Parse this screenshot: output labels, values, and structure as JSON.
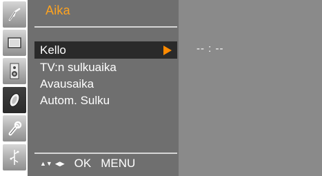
{
  "menu": {
    "title": "Aika",
    "items": [
      {
        "label": "Kello",
        "selected": true
      },
      {
        "label": "TV:n sulkuaika",
        "selected": false
      },
      {
        "label": "Avausaika",
        "selected": false
      },
      {
        "label": "Autom. Sulku",
        "selected": false
      }
    ]
  },
  "value": {
    "clock": "-- : --"
  },
  "footer": {
    "nav_icons": [
      "up-down-arrows-icon",
      "left-right-arrows-icon"
    ],
    "ok_label": "OK",
    "menu_label": "MENU"
  },
  "sidebar": {
    "icons": [
      "antenna-icon",
      "screen-icon",
      "speaker-icon",
      "clock-disc-icon",
      "wrench-icon",
      "input-plug-icon"
    ],
    "active_index": 3
  },
  "colors": {
    "title": "#ffa31f",
    "panel": "#6f6f6f",
    "value_area": "#8a8a8a",
    "selection": "#2a2a2a",
    "arrow": "#ff8a00"
  }
}
